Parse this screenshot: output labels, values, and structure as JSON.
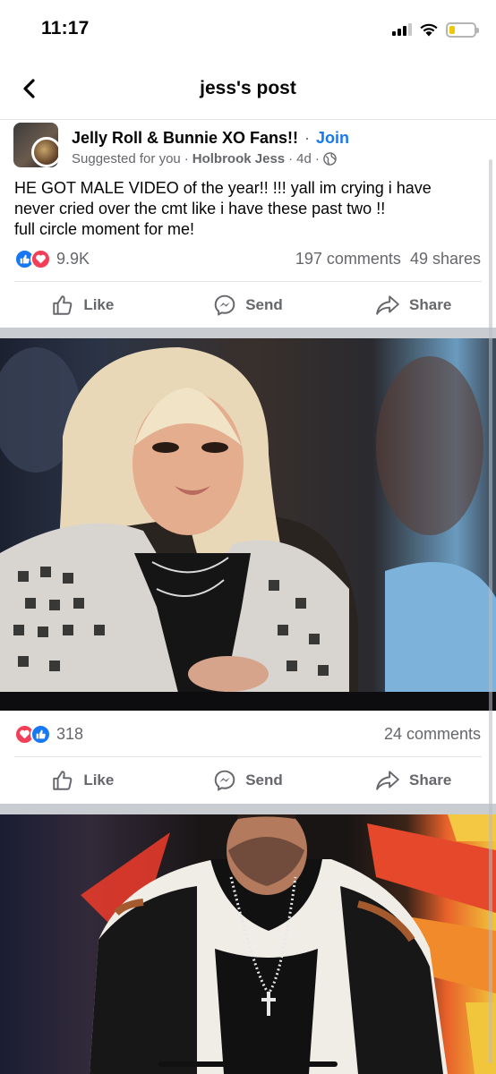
{
  "status_bar": {
    "time": "11:17",
    "battery_color": "#f0c800"
  },
  "header": {
    "title": "jess's post",
    "back_icon": "chevron-left-icon"
  },
  "post": {
    "group_name": "Jelly Roll & Bunnie XO Fans!!",
    "join_label": "Join",
    "suggested": "Suggested for you",
    "author": "Holbrook Jess",
    "time": "4d",
    "privacy_icon": "globe-icon",
    "text_lines": [
      "HE GOT MALE VIDEO of the year!! !!! yall im crying i have",
      "never cried over the cmt like i have these past two !!",
      "full circle moment for me!"
    ],
    "reaction_count": "9.9K",
    "comments": "197 comments",
    "shares": "49 shares",
    "actions": [
      "Like",
      "Send",
      "Share"
    ]
  },
  "photo_1": {
    "reaction_count": "318",
    "comments": "24 comments",
    "actions": [
      "Like",
      "Send",
      "Share"
    ]
  },
  "colors": {
    "accent": "#1877f2",
    "love": "#f33e58",
    "secondary_text": "#65676b"
  }
}
